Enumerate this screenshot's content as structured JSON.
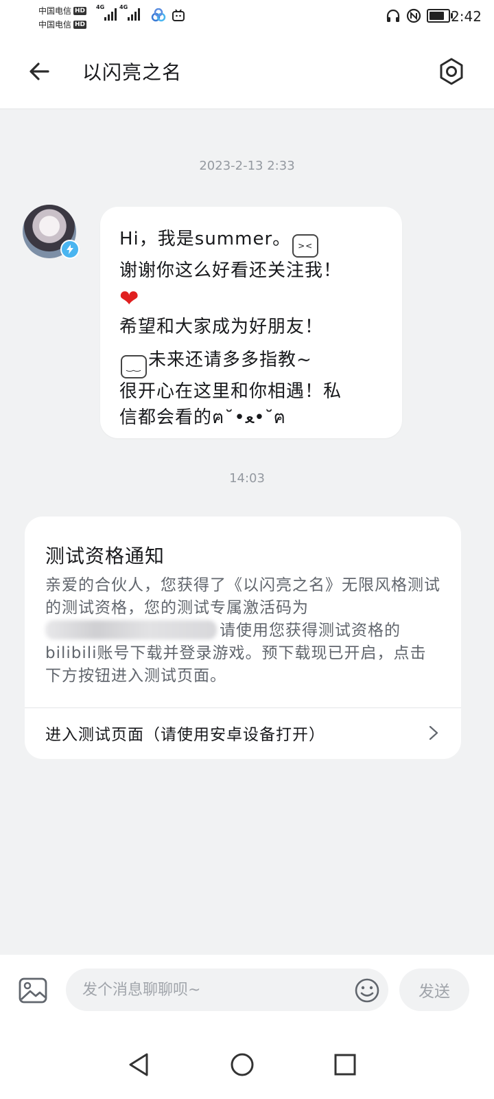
{
  "status_bar": {
    "carrier_1": "中国电信",
    "carrier_2": "中国电信",
    "hd_label": "HD",
    "network_label": "4G",
    "time": "2:42",
    "battery_level": 0.8
  },
  "header": {
    "title": "以闪亮之名"
  },
  "messages": [
    {
      "timestamp": "2023-2-13 2:33",
      "lines": [
        "Hi，我是summer。",
        "谢谢你这么好看还关注我！",
        "",
        "希望和大家成为好朋友！",
        "未来还请多多指教~",
        "很开心在这里和你相遇！私",
        "信都会看的ฅ˘•ﻌ•˘ฅ"
      ]
    }
  ],
  "notice": {
    "timestamp": "14:03",
    "title": "测试资格通知",
    "body_1": "亲爱的合伙人，您获得了《以闪亮之名》无限风格测试的测试资格，您的测试专属激活码为",
    "body_2": "请使用您获得测试资格的bilibili账号下载并登录游戏。预下载现已开启，点击下方按钮进入测试页面。",
    "link": "进入测试页面（请使用安卓设备打开）"
  },
  "composer": {
    "placeholder": "发个消息聊聊呗~",
    "send_label": "发送"
  }
}
